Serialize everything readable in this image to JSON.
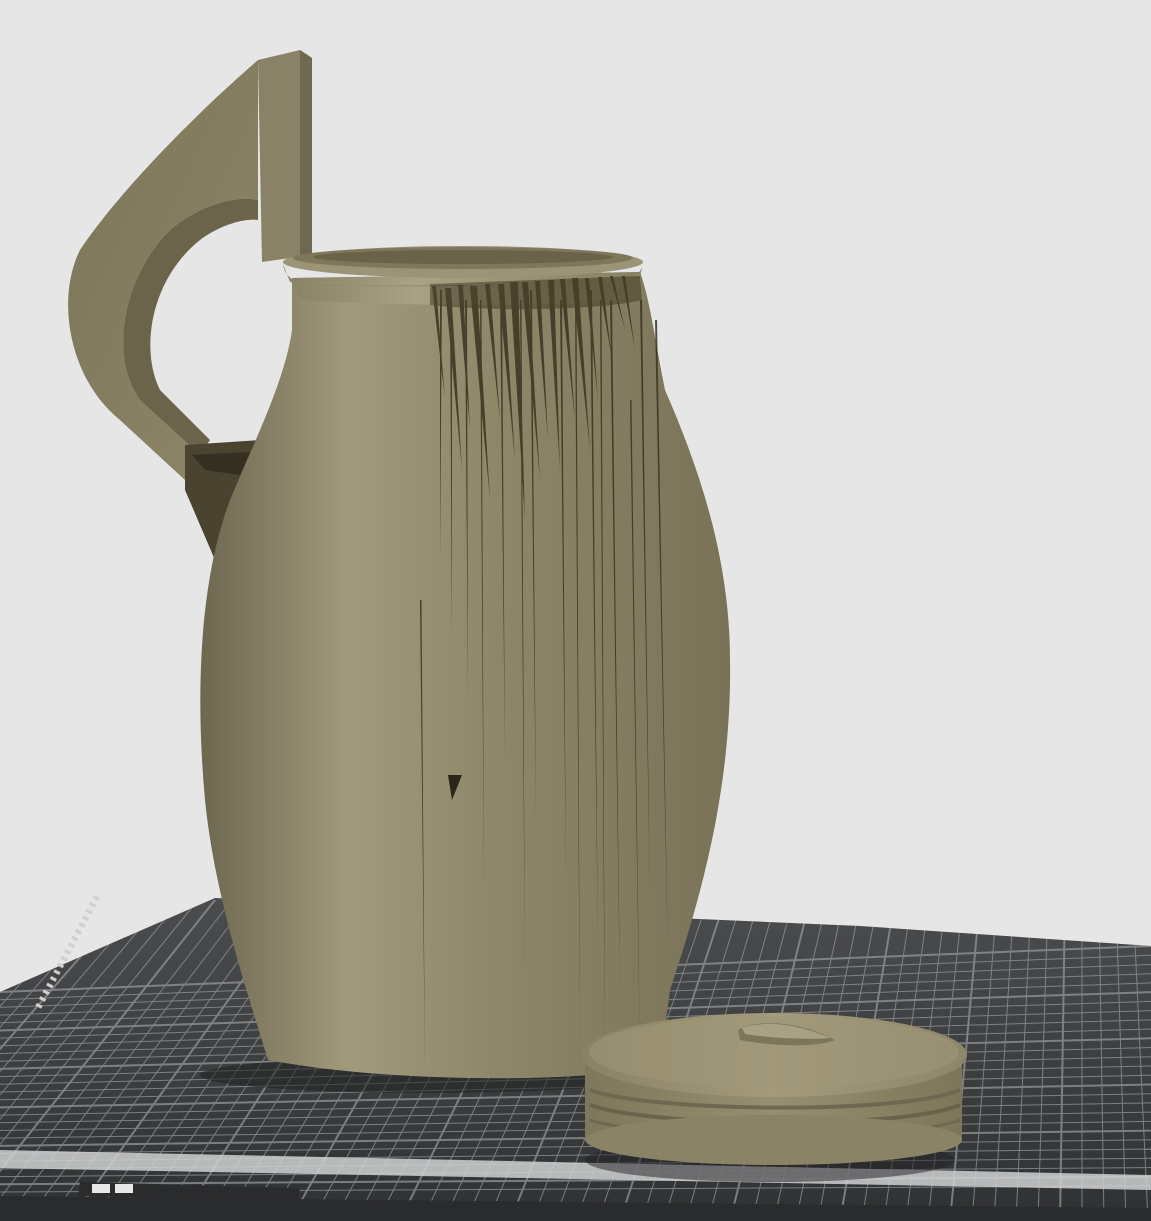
{
  "viewport": {
    "background_color": "#e6e6e6"
  },
  "build_plate": {
    "surface_color": "#3a3c3e",
    "grid_color": "#9a9c9e",
    "edge_color": "#2a2b2c",
    "front_strip_color": "#cfd0d1"
  },
  "models": {
    "pitcher": {
      "color": "#8c8466",
      "artifact_color": "#3a3320"
    },
    "lid": {
      "color": "#948c6c"
    }
  }
}
